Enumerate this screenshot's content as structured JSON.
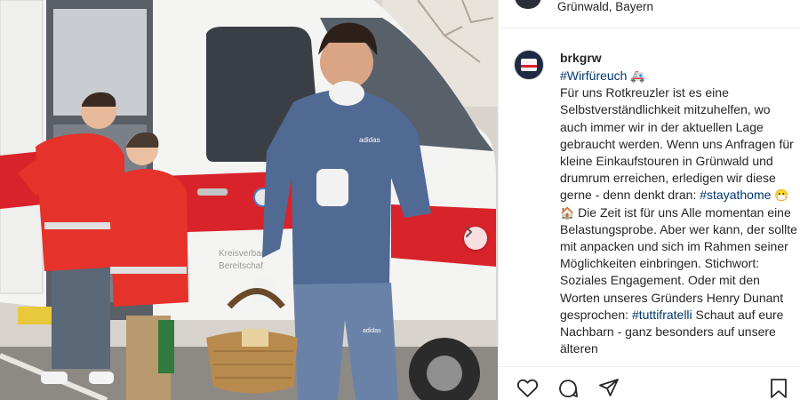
{
  "location": {
    "text": "Grünwald, Bayern"
  },
  "post": {
    "username": "brkgrw",
    "hashtag_1": "#Wirfüreuch",
    "emoji_1": "🚑",
    "text_1": "Für uns Rotkreuzler ist es eine Selbstverständlichkeit mitzuhelfen, wo auch immer wir in der aktuellen Lage gebraucht werden. Wenn uns Anfragen für kleine Einkaufstouren in Grünwald und drumrum erreichen, erledigen wir diese gerne - denn denkt dran:",
    "hashtag_2": "#stayathome",
    "emoji_2": "😷",
    "emoji_3": "🏠",
    "text_2": "Die Zeit ist für uns Alle momentan eine Belastungsprobe. Aber wer kann, der sollte mit anpacken und sich im Rahmen seiner Möglichkeiten einbringen. Stichwort: Soziales Engagement. Oder mit den Worten unseres Gründers Henry Dunant gesprochen:",
    "hashtag_3": "#tuttifratelli",
    "text_3": "Schaut auf eure Nachbarn - ganz besonders auf unsere älteren"
  },
  "photo": {
    "van_side_text_1": "Kreisverban",
    "van_side_text_2": "Bereitschaf",
    "hoodie_brand": "adidas",
    "pants_brand": "adidas"
  },
  "icons": {
    "next": "chevron-right-icon",
    "like": "heart-icon",
    "comment": "comment-icon",
    "share": "share-icon",
    "save": "bookmark-icon"
  },
  "colors": {
    "text": "#262626",
    "hashtag": "#00376b",
    "border": "#efefef",
    "redcross": "#d8232a"
  }
}
